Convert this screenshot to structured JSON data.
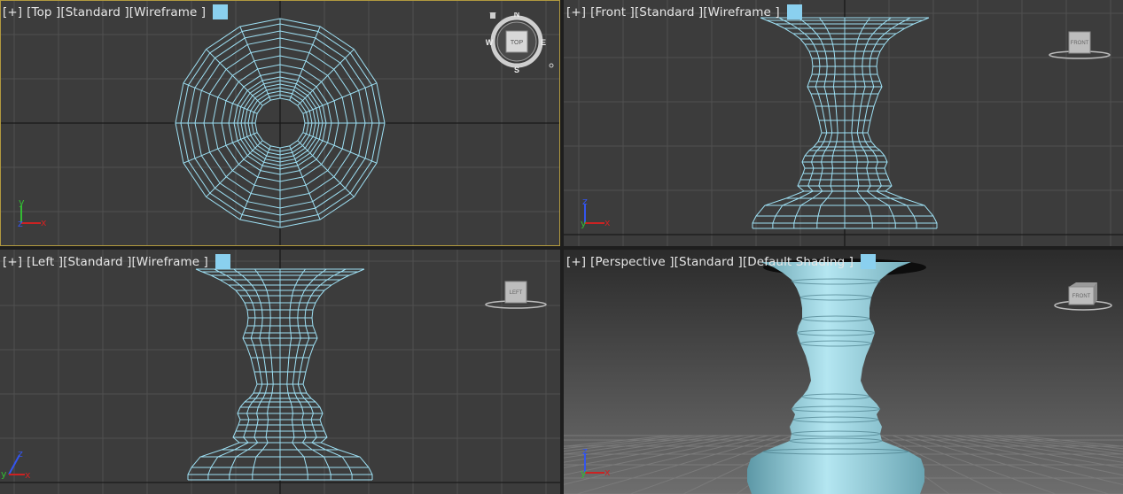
{
  "colors": {
    "viewport_bg": "#3c3c3c",
    "grid": "#505050",
    "grid_axis": "#191919",
    "wire": "#9ee0f4",
    "shaded": "#8ec9d6",
    "active_border": "#b1993f",
    "swatch": "#8ad0ef",
    "axis_x": "#cc2222",
    "axis_y": "#33bb33",
    "axis_z": "#3355ee"
  },
  "viewports": {
    "top": {
      "menu": "[+]",
      "view": "[Top ]",
      "mode": "[Standard ]",
      "shading": "[Wireframe ]",
      "compass": {
        "n": "N",
        "s": "S",
        "e": "E",
        "w": "W",
        "cube": "TOP"
      },
      "axis": {
        "a": "y",
        "b": "z",
        "c": "x"
      }
    },
    "front": {
      "menu": "[+]",
      "view": "[Front ]",
      "mode": "[Standard ]",
      "shading": "[Wireframe ]",
      "cube": "FRONT",
      "axis": {
        "a": "z",
        "b": "y",
        "c": "x"
      }
    },
    "left": {
      "menu": "[+]",
      "view": "[Left ]",
      "mode": "[Standard ]",
      "shading": "[Wireframe ]",
      "cube": "LEFT",
      "axis": {
        "a": "z",
        "b": "y",
        "c": "x"
      }
    },
    "perspective": {
      "menu": "[+]",
      "view": "[Perspective ]",
      "mode": "[Standard ]",
      "shading": "[Default Shading ]",
      "cube": "FRONT",
      "axis": {
        "a": "z",
        "b": "y",
        "c": "x"
      }
    }
  }
}
